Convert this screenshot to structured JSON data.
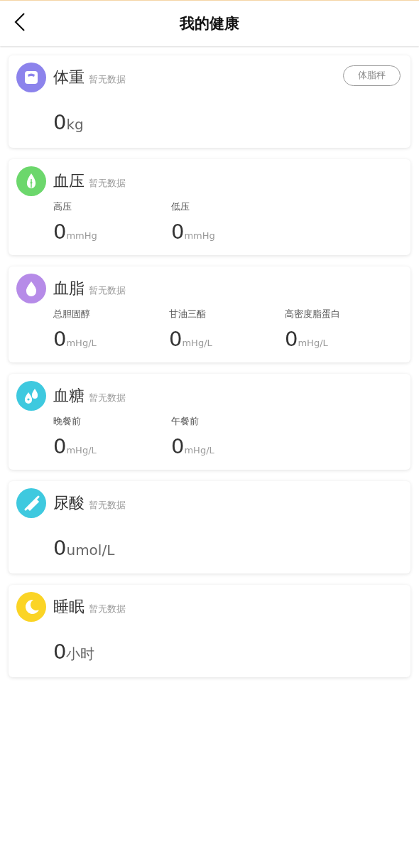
{
  "header": {
    "title": "我的健康"
  },
  "cards": [
    {
      "kind": "single",
      "color": "#8c83ec",
      "title": "体重",
      "status": "暂无数据",
      "action": "体脂秤",
      "metrics": [
        {
          "value": "0",
          "unit": "kg"
        }
      ]
    },
    {
      "kind": "multi",
      "color": "#6cd76c",
      "title": "血压",
      "status": "暂无数据",
      "metrics": [
        {
          "label": "高压",
          "value": "0",
          "unit": "mmHg"
        },
        {
          "label": "低压",
          "value": "0",
          "unit": "mmHg"
        }
      ]
    },
    {
      "kind": "multi",
      "color": "#b68be8",
      "title": "血脂",
      "status": "暂无数据",
      "metrics": [
        {
          "label": "总胆固醇",
          "value": "0",
          "unit": "mHg/L"
        },
        {
          "label": "甘油三酯",
          "value": "0",
          "unit": "mHg/L"
        },
        {
          "label": "高密度脂蛋白",
          "value": "0",
          "unit": "mHg/L"
        }
      ]
    },
    {
      "kind": "multi",
      "color": "#3ec9df",
      "title": "血糖",
      "status": "暂无数据",
      "metrics": [
        {
          "label": "晚餐前",
          "value": "0",
          "unit": "mHg/L"
        },
        {
          "label": "午餐前",
          "value": "0",
          "unit": "mHg/L"
        }
      ]
    },
    {
      "kind": "single",
      "color": "#3ec9df",
      "title": "尿酸",
      "status": "暂无数据",
      "metrics": [
        {
          "value": "0",
          "unit": "umol/L"
        }
      ]
    },
    {
      "kind": "single",
      "color": "#fbd425",
      "title": "睡眠",
      "status": "暂无数据",
      "metrics": [
        {
          "value": "0",
          "unit": "小时"
        }
      ]
    }
  ]
}
